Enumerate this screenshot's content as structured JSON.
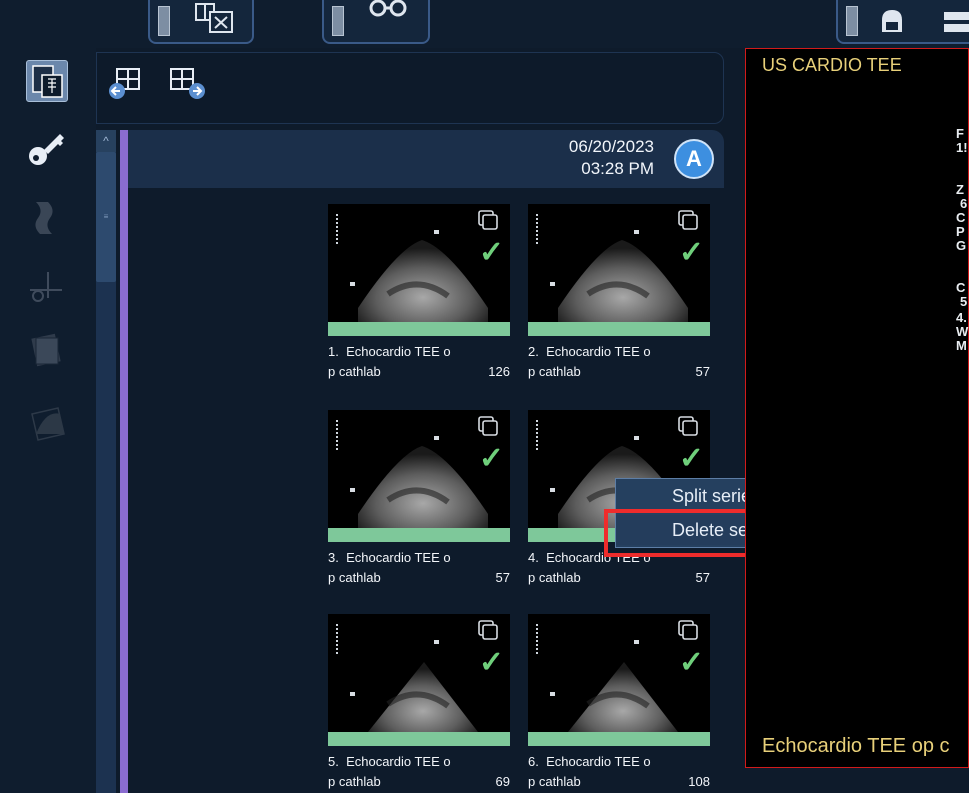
{
  "viewer": {
    "title": "US CARDIO TEE",
    "footer": "Echocardio TEE op c",
    "side_glyphs": [
      "F",
      "1!",
      "Z",
      "6",
      "C",
      "P",
      "G",
      "C",
      "5",
      "4.",
      "W",
      "M"
    ]
  },
  "study": {
    "date": "06/20/2023",
    "time": "03:28 PM",
    "badge": "A"
  },
  "series": [
    {
      "line1": "1.  Echocardio TEE o",
      "line2": "p cathlab",
      "count": "126"
    },
    {
      "line1": "2.  Echocardio TEE o",
      "line2": "p cathlab",
      "count": "57"
    },
    {
      "line1": "3.  Echocardio TEE o",
      "line2": "p cathlab",
      "count": "57"
    },
    {
      "line1": "4.  Echocardio TEE o",
      "line2": "p cathlab",
      "count": "57"
    },
    {
      "line1": "5.  Echocardio TEE o",
      "line2": "p cathlab",
      "count": "69"
    },
    {
      "line1": "6.  Echocardio TEE o",
      "line2": "p cathlab",
      "count": "108"
    }
  ],
  "context_menu": {
    "items": [
      "Split series",
      "Delete series"
    ]
  },
  "colors": {
    "highlight": "#ee2c2c",
    "accent": "#3d8fe0",
    "check": "#6fcf7b",
    "viewer_text": "#e8d07a"
  }
}
